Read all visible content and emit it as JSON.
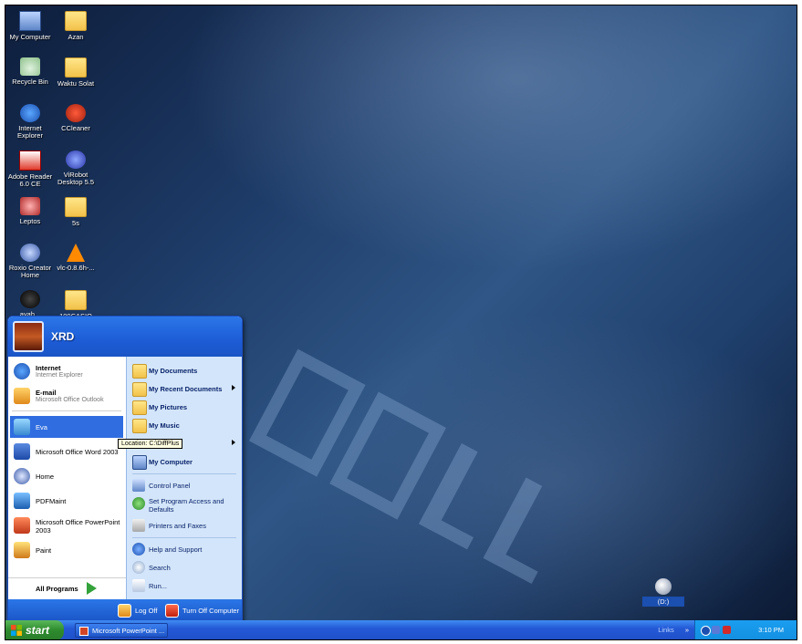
{
  "desktop_icons": [
    {
      "label": "My Computer",
      "icon": "my-computer-icon"
    },
    {
      "label": "Azan",
      "icon": "folder-icon"
    },
    {
      "label": "Recycle Bin",
      "icon": "recycle-bin-icon"
    },
    {
      "label": "Waktu Solat",
      "icon": "folder-icon"
    },
    {
      "label": "Internet Explorer",
      "icon": "internet-explorer-icon"
    },
    {
      "label": "CCleaner",
      "icon": "ccleaner-icon"
    },
    {
      "label": "Adobe Reader 6.0 CE",
      "icon": "adobe-reader-icon"
    },
    {
      "label": "ViRobot Desktop 5.5",
      "icon": "virobot-icon"
    },
    {
      "label": "Leptos",
      "icon": "leptos-icon"
    },
    {
      "label": "5s",
      "icon": "folder-icon"
    },
    {
      "label": "Roxio Creator Home",
      "icon": "roxio-icon"
    },
    {
      "label": "vlc-0.8.6h-...",
      "icon": "vlc-icon"
    },
    {
      "label": "ayah...",
      "icon": "spider-icon"
    },
    {
      "label": "100CASIO",
      "icon": "folder-icon"
    }
  ],
  "start_menu": {
    "username": "XRD",
    "pinned": [
      {
        "title": "Internet",
        "subtitle": "Internet Explorer"
      },
      {
        "title": "E-mail",
        "subtitle": "Microsoft Office Outlook"
      }
    ],
    "recent": [
      {
        "label": "Eva"
      },
      {
        "label": "Microsoft Office Word 2003"
      },
      {
        "label": "Home"
      },
      {
        "label": "PDFMaint"
      },
      {
        "label": "Microsoft Office PowerPoint 2003"
      },
      {
        "label": "Paint"
      }
    ],
    "all_programs": "All Programs",
    "right": [
      {
        "label": "My Documents"
      },
      {
        "label": "My Recent Documents"
      },
      {
        "label": "My Pictures"
      },
      {
        "label": "My Music"
      },
      {
        "label": ""
      },
      {
        "label": "My Computer"
      },
      {
        "label": "Control Panel"
      },
      {
        "label": "Set Program Access and Defaults"
      },
      {
        "label": "Printers and Faxes"
      },
      {
        "label": "Help and Support"
      },
      {
        "label": "Search"
      },
      {
        "label": "Run..."
      }
    ],
    "log_off": "Log Off",
    "turn_off": "Turn Off Computer"
  },
  "tooltip": "Location: C:\\DiffPlus",
  "drive_icon": {
    "label": "(D:)"
  },
  "taskbar": {
    "start_label": "start",
    "tasks": [
      {
        "label": "Microsoft PowerPoint ..."
      }
    ],
    "links": "Links",
    "links_chevron": "»",
    "clock": "3:10 PM"
  },
  "colors": {
    "taskbar": "#2459d6",
    "start_button": "#2e8b2e",
    "menu_right_pane": "#d3e5fa"
  }
}
